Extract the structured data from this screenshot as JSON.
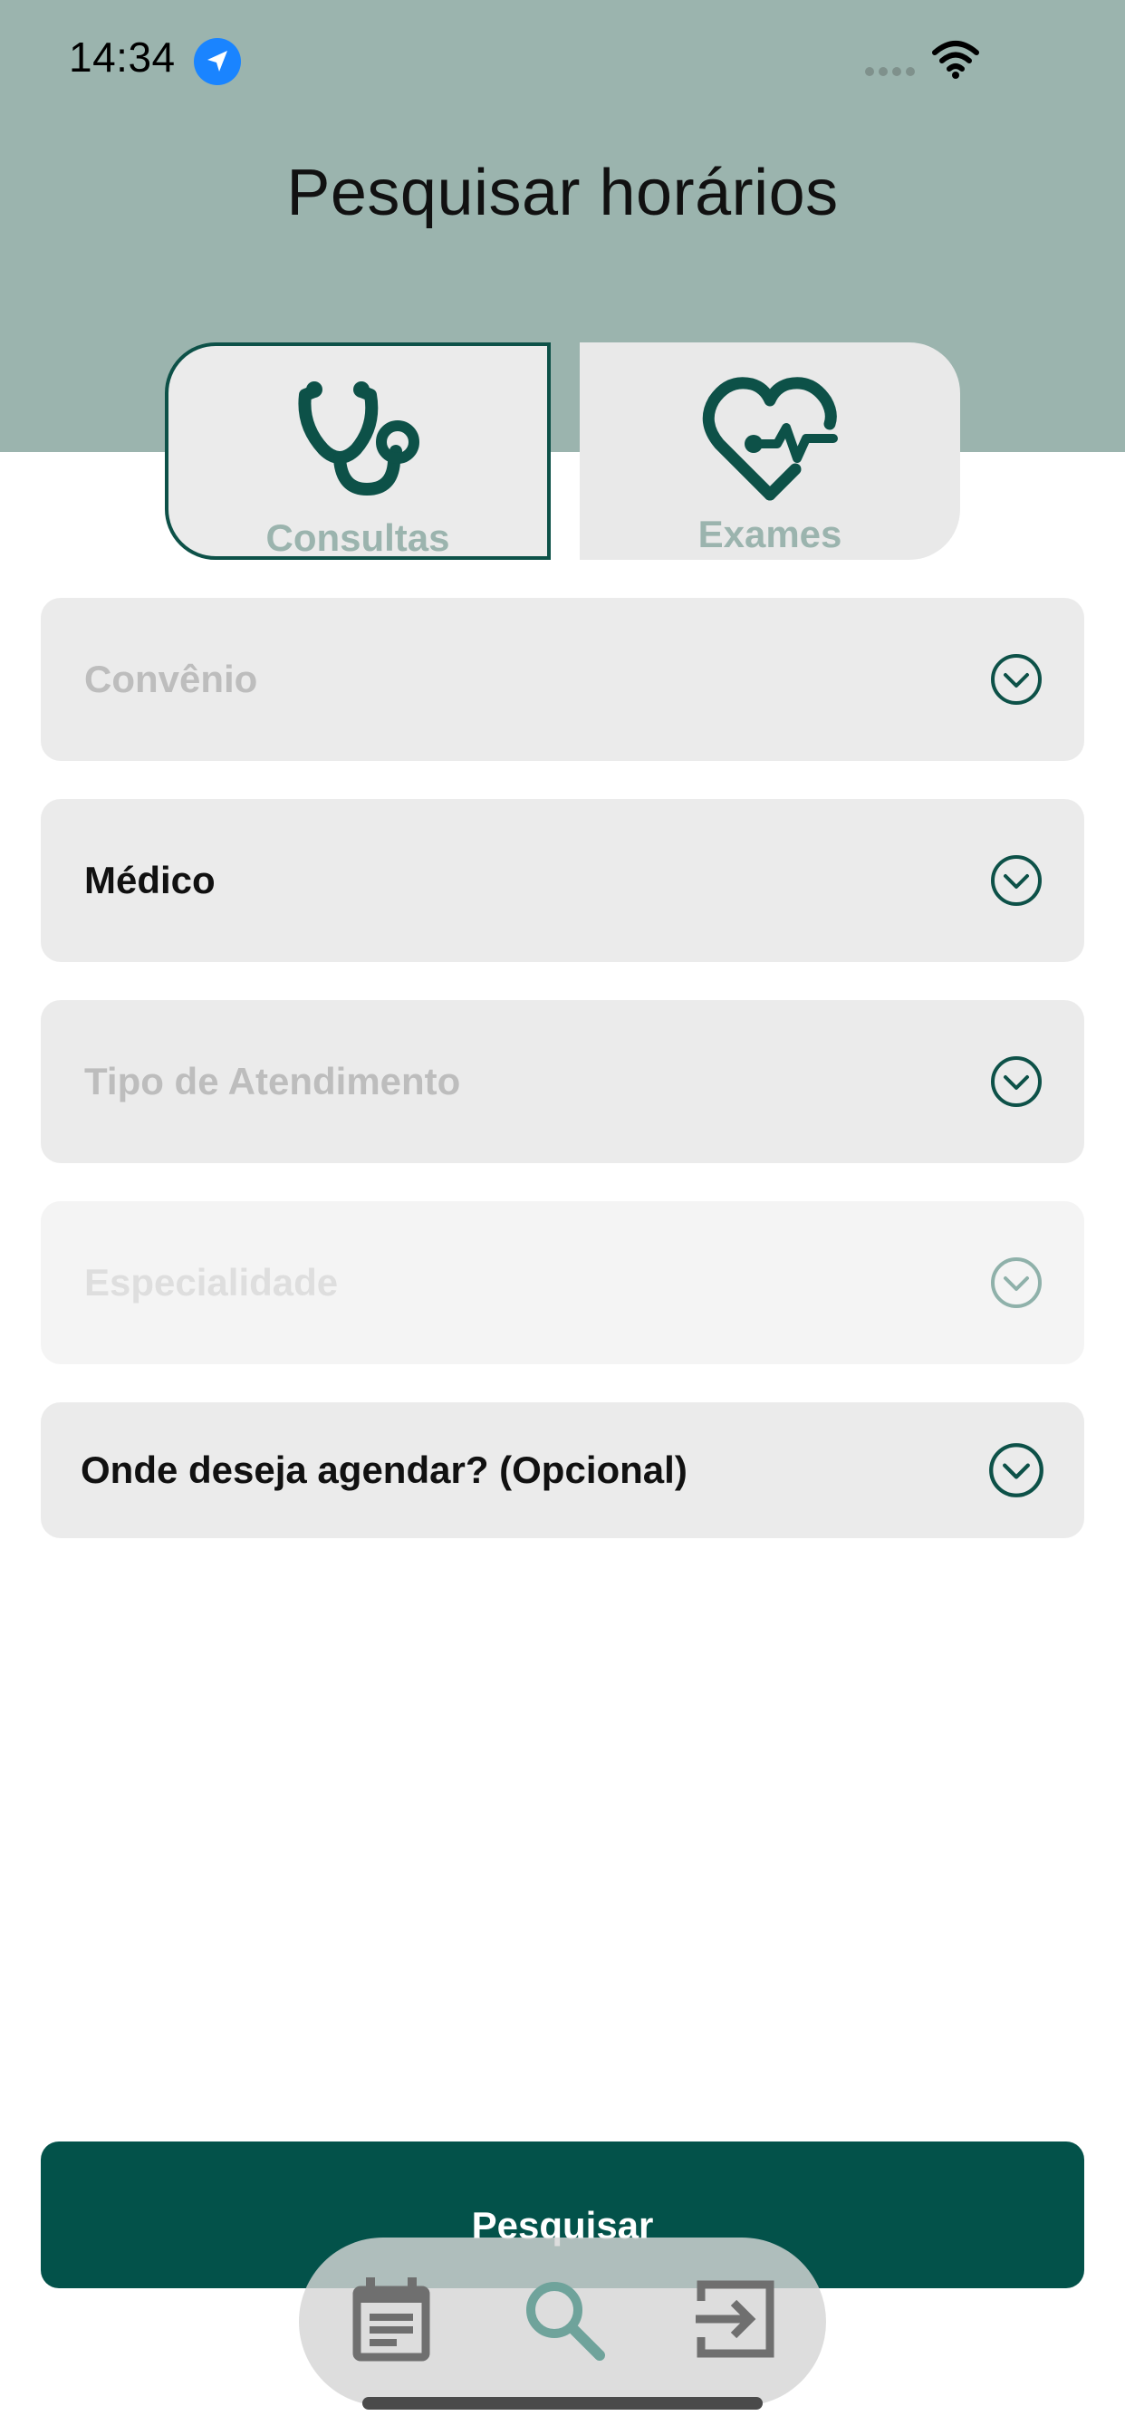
{
  "status_bar": {
    "time": "14:34",
    "icons": [
      "location-arrow-icon",
      "cellular-signal-icon",
      "wifi-icon"
    ]
  },
  "page": {
    "title": "Pesquisar horários"
  },
  "tabs": [
    {
      "label": "Consultas",
      "icon": "stethoscope-icon",
      "selected": true
    },
    {
      "label": "Exames",
      "icon": "heart-pulse-icon",
      "selected": false
    }
  ],
  "form": {
    "fields": [
      {
        "label": "Convênio",
        "state": "placeholder"
      },
      {
        "label": "Médico",
        "state": "selected"
      },
      {
        "label": "Tipo de Atendimento",
        "state": "placeholder"
      },
      {
        "label": "Especialidade",
        "state": "disabled"
      },
      {
        "label": "Onde deseja agendar? (Opcional)",
        "state": "selected"
      }
    ],
    "submit_label": "Pesquisar"
  },
  "bottom_nav": {
    "items": [
      {
        "icon": "calendar-icon",
        "active": false
      },
      {
        "icon": "search-icon",
        "active": true
      },
      {
        "icon": "logout-icon",
        "active": false
      }
    ]
  },
  "colors": {
    "header": "#9bb4ae",
    "primary": "#03524a",
    "field_bg": "#ebebeb",
    "placeholder": "#bdbdbd"
  }
}
